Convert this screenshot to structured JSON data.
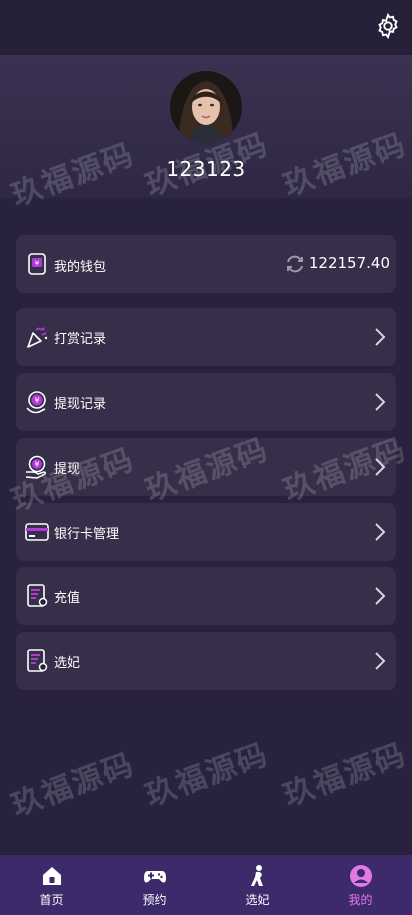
{
  "header": {
    "settings_icon": "gear-icon"
  },
  "profile": {
    "username": "123123",
    "avatar_icon": "avatar"
  },
  "wallet": {
    "label": "我的钱包",
    "balance": "122157.40",
    "refresh_icon": "refresh-icon",
    "icon": "wallet-icon"
  },
  "menu": [
    {
      "label": "打赏记录",
      "icon": "party-popper-icon"
    },
    {
      "label": "提现记录",
      "icon": "yuan-coin-icon"
    },
    {
      "label": "提现",
      "icon": "yuan-coin-hand-icon"
    },
    {
      "label": "银行卡管理",
      "icon": "bank-card-icon"
    },
    {
      "label": "充值",
      "icon": "recharge-doc-icon"
    },
    {
      "label": "选妃",
      "icon": "select-doc-icon"
    }
  ],
  "watermark": "玖福源码",
  "tabbar": {
    "tabs": [
      {
        "label": "首页",
        "icon": "home-icon"
      },
      {
        "label": "预约",
        "icon": "gamepad-icon"
      },
      {
        "label": "选妃",
        "icon": "figure-icon"
      },
      {
        "label": "我的",
        "icon": "user-circle-icon"
      }
    ],
    "active_index": 3,
    "active_color": "#e07ae8",
    "background": "#3c2a6b"
  }
}
